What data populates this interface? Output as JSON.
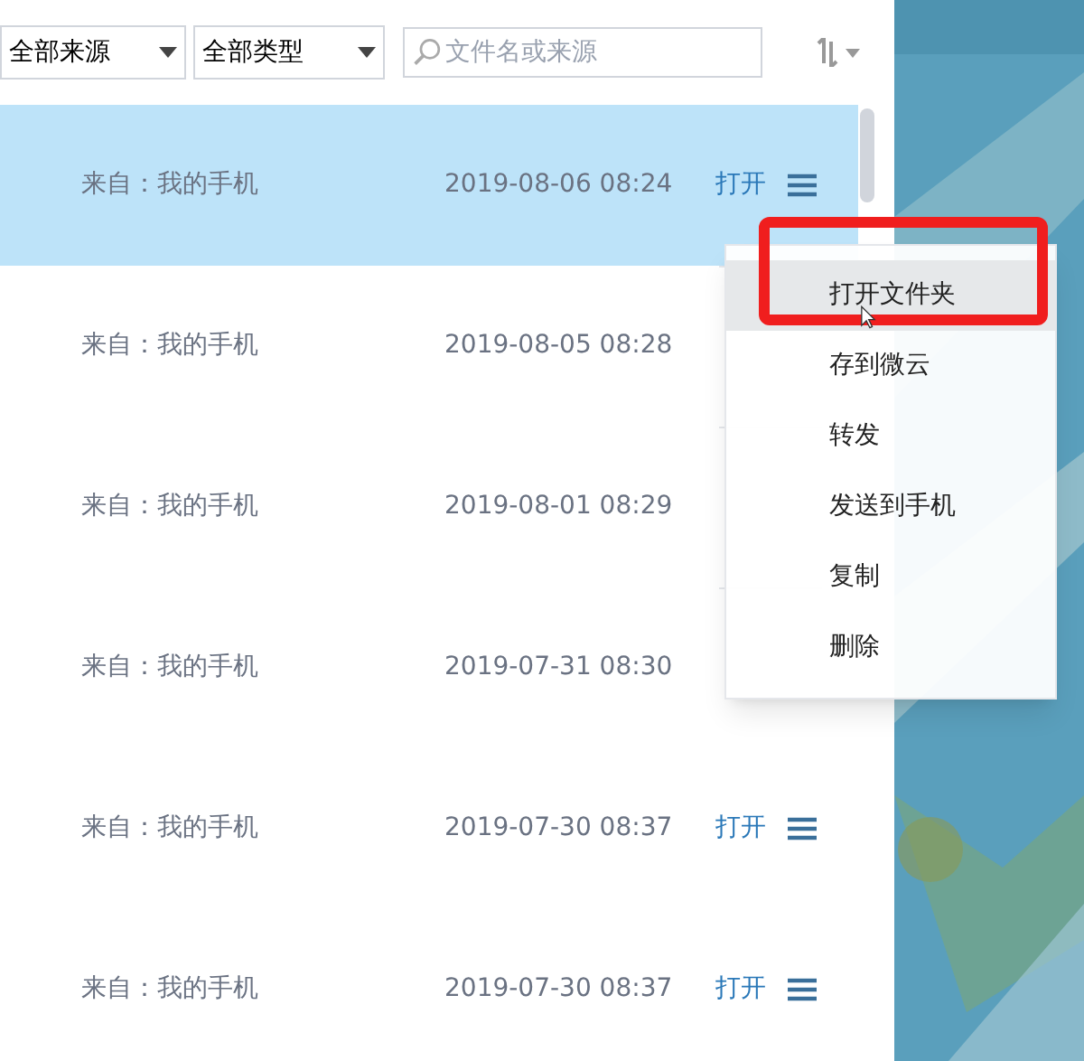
{
  "toolbar": {
    "source_filter": "全部来源",
    "type_filter": "全部类型",
    "search": {
      "placeholder": "文件名或来源"
    }
  },
  "rows": [
    {
      "source": "来自：我的手机",
      "time": "2019-08-06 08:24",
      "action": "打开",
      "selected": true
    },
    {
      "source": "来自：我的手机",
      "time": "2019-08-05 08:28",
      "selected": false
    },
    {
      "source": "来自：我的手机",
      "time": "2019-08-01 08:29",
      "selected": false
    },
    {
      "source": "来自：我的手机",
      "time": "2019-07-31 08:30",
      "selected": false
    },
    {
      "source": "来自：我的手机",
      "time": "2019-07-30 08:37",
      "action": "打开",
      "selected": false
    },
    {
      "source": "来自：我的手机",
      "time": "2019-07-30 08:37",
      "action": "打开",
      "selected": false
    }
  ],
  "context_menu": {
    "items": [
      {
        "label": "打开文件夹",
        "selected": true
      },
      {
        "label": "存到微云",
        "selected": false
      },
      {
        "label": "转发",
        "selected": false
      },
      {
        "label": "发送到手机",
        "selected": false
      },
      {
        "label": "复制",
        "selected": false
      },
      {
        "label": "删除",
        "selected": false
      }
    ]
  }
}
